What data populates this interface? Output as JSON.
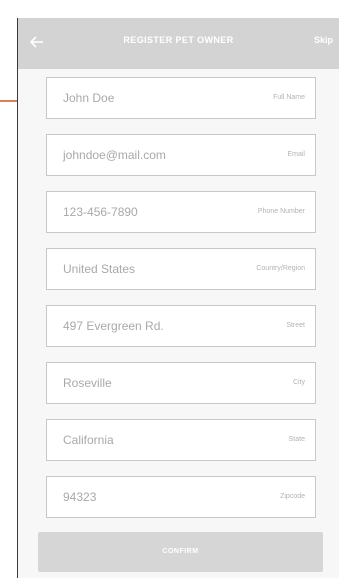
{
  "header": {
    "title": "REGISTER PET OWNER",
    "back_icon": "arrow-left-icon",
    "skip_label": "Skip"
  },
  "form": {
    "fields": [
      {
        "value": "John Doe",
        "label": "Full Name"
      },
      {
        "value": "johndoe@mail.com",
        "label": "Email"
      },
      {
        "value": "123-456-7890",
        "label": "Phone Number"
      },
      {
        "value": "United States",
        "label": "Country/Region"
      },
      {
        "value": "497 Evergreen Rd.",
        "label": "Street"
      },
      {
        "value": "Roseville",
        "label": "City"
      },
      {
        "value": "California",
        "label": "State"
      },
      {
        "value": "94323",
        "label": "Zipcode"
      }
    ]
  },
  "confirm_label": "CONFIRM",
  "colors": {
    "header_bg": "#d3d3d3",
    "annotation_arrow": "#d4551f",
    "button_bg": "#d6d6d6"
  }
}
